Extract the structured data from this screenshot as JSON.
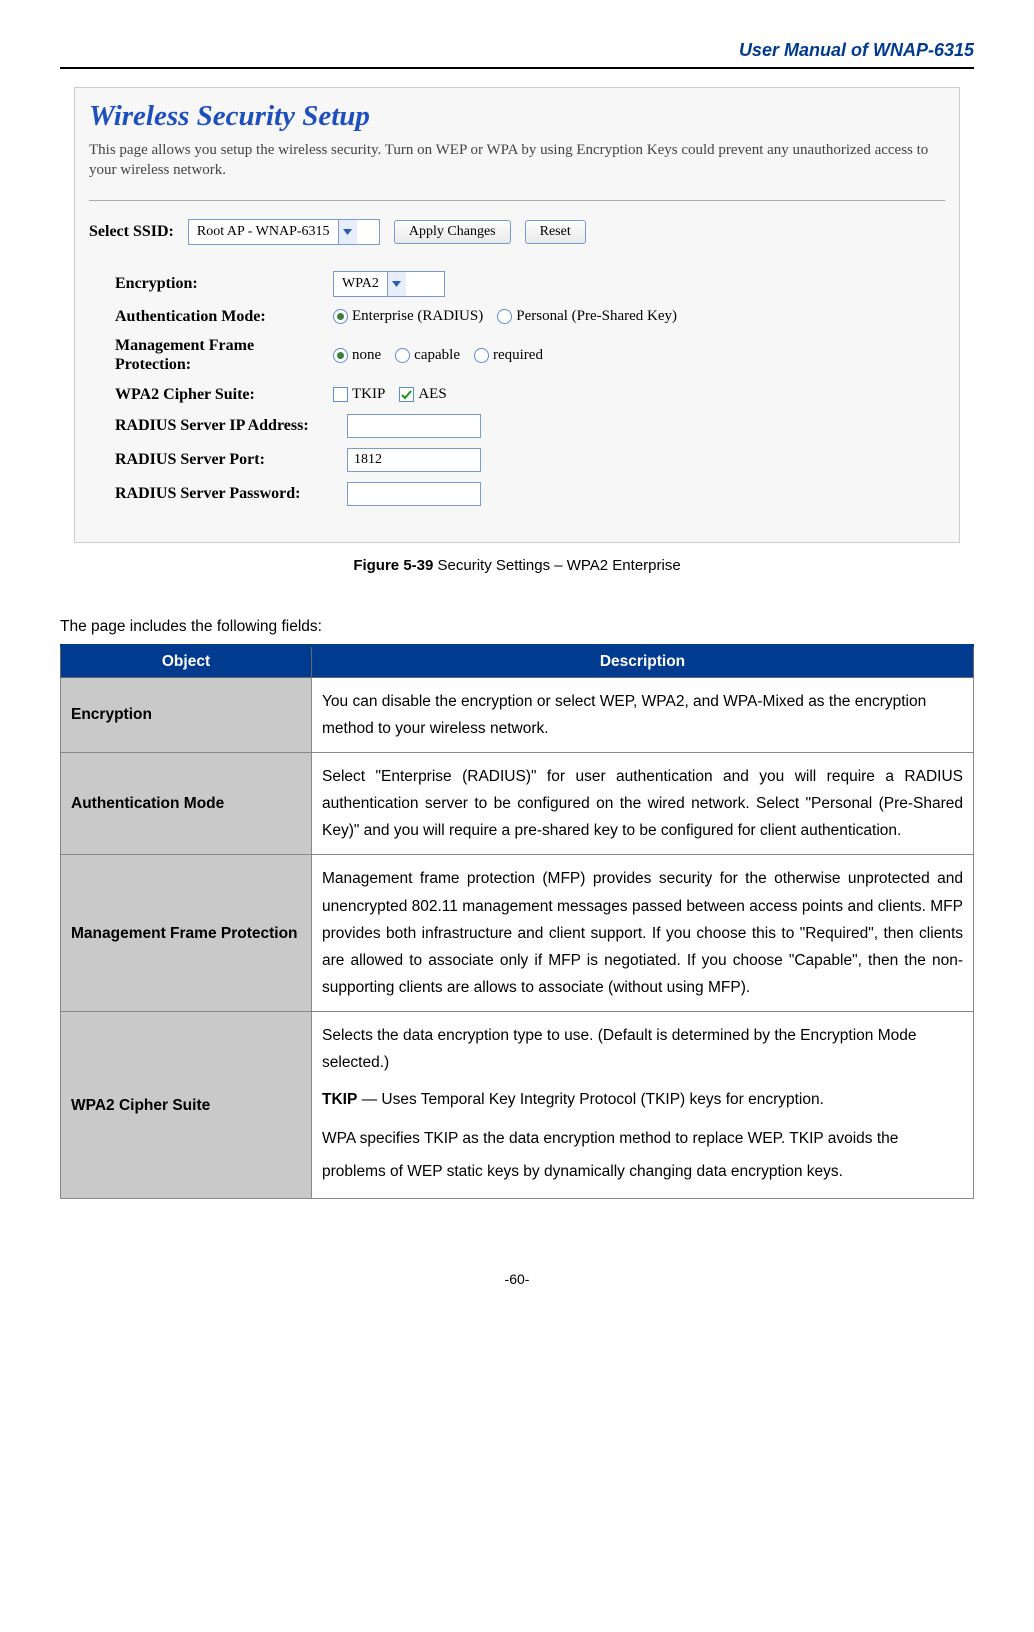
{
  "header": {
    "doc_title": "User Manual of WNAP-6315"
  },
  "panel": {
    "title": "Wireless Security Setup",
    "intro": "This page allows you setup the wireless security. Turn on WEP or WPA by using Encryption Keys could prevent any unauthorized access to your wireless network.",
    "ssid_label": "Select SSID:",
    "ssid_value": "Root AP - WNAP-6315",
    "apply_btn": "Apply Changes",
    "reset_btn": "Reset",
    "rows": {
      "encryption": {
        "label": "Encryption:",
        "value": "WPA2"
      },
      "auth_mode": {
        "label": "Authentication Mode:",
        "opt1": "Enterprise (RADIUS)",
        "opt2": "Personal (Pre-Shared Key)"
      },
      "mfp": {
        "label": "Management Frame Protection:",
        "opt1": "none",
        "opt2": "capable",
        "opt3": "required"
      },
      "cipher": {
        "label": "WPA2 Cipher Suite:",
        "opt1": "TKIP",
        "opt2": "AES"
      },
      "radius_ip": {
        "label": "RADIUS Server IP Address:",
        "value": ""
      },
      "radius_port": {
        "label": "RADIUS Server Port:",
        "value": "1812"
      },
      "radius_pw": {
        "label": "RADIUS Server Password:",
        "value": ""
      }
    }
  },
  "caption": {
    "fig_num": "Figure 5-39",
    "fig_text": " Security Settings – WPA2 Enterprise"
  },
  "lead": "The page includes the following fields:",
  "table": {
    "head_obj": "Object",
    "head_desc": "Description",
    "rows": [
      {
        "obj": "Encryption",
        "desc": "You can disable the encryption or select WEP, WPA2, and WPA-Mixed as the encryption method to your wireless network."
      },
      {
        "obj": "Authentication Mode",
        "desc": "Select \"Enterprise (RADIUS)\" for user authentication and you will require a RADIUS authentication server to be configured on the wired network. Select \"Personal (Pre-Shared Key)\" and you will require a pre-shared key to be configured for client authentication."
      },
      {
        "obj": "Management Frame Protection",
        "desc": "Management frame protection (MFP) provides security for the otherwise unprotected and unencrypted 802.11 management messages passed between access points and clients. MFP provides both infrastructure and client support. If you choose this to \"Required\", then clients are allowed to associate only if MFP is negotiated. If you choose \"Capable\", then the non-supporting clients are allows to associate (without using MFP)."
      },
      {
        "obj": "WPA2 Cipher Suite",
        "desc_p1": "Selects the data encryption type to use. (Default is determined by the Encryption Mode selected.)",
        "desc_p2a": "TKIP",
        "desc_p2b": " — Uses Temporal Key Integrity Protocol (TKIP) keys for encryption.",
        "desc_p3": "WPA specifies TKIP as the data encryption method to replace WEP. TKIP avoids the problems of WEP static keys by dynamically changing data encryption keys."
      }
    ]
  },
  "page_num": "-60-"
}
